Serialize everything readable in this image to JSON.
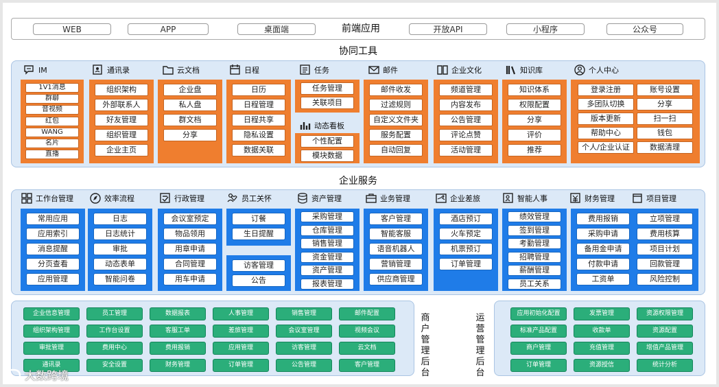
{
  "frontend": {
    "items": [
      "WEB",
      "APP",
      "桌面端",
      "前端应用",
      "开放API",
      "小程序",
      "公众号"
    ]
  },
  "collab": {
    "title": "协同工具",
    "columns": [
      {
        "name": "IM",
        "icon": "chat-icon",
        "items": [
          "1V1消息",
          "群聊",
          "音视频",
          "红包",
          "WANG",
          "名片",
          "直播"
        ]
      },
      {
        "name": "通讯录",
        "icon": "contacts-icon",
        "items": [
          "组织架构",
          "外部联系人",
          "好友管理",
          "组织管理",
          "企业主页"
        ]
      },
      {
        "name": "云文档",
        "icon": "folder-cloud-icon",
        "items": [
          "企业盘",
          "私人盘",
          "群文档",
          "分享"
        ]
      },
      {
        "name": "日程",
        "icon": "calendar-icon",
        "items": [
          "日历",
          "日程管理",
          "日程共享",
          "隐私设置",
          "数据关联"
        ]
      },
      {
        "name": "任务",
        "icon": "checklist-icon",
        "items": [
          "任务管理",
          "关联项目"
        ],
        "sub_name": "动态看板",
        "sub_icon": "bar-chart-icon",
        "sub_items": [
          "个性配置",
          "模块数据"
        ]
      },
      {
        "name": "邮件",
        "icon": "mail-icon",
        "items": [
          "邮件收发",
          "过滤规则",
          "自定义文件夹",
          "服务配置",
          "自动回复"
        ]
      },
      {
        "name": "企业文化",
        "icon": "book-icon",
        "items": [
          "频道管理",
          "内容发布",
          "公告管理",
          "评论点赞",
          "活动管理"
        ]
      },
      {
        "name": "知识库",
        "icon": "library-icon",
        "items": [
          "知识体系",
          "权限配置",
          "分享",
          "评价",
          "推荐"
        ]
      },
      {
        "name": "个人中心",
        "icon": "user-icon",
        "items": [
          "登录注册",
          "多团队切换",
          "版本更新",
          "帮助中心",
          "个人/企业认证"
        ],
        "items2": [
          "账号设置",
          "分享",
          "扫一扫",
          "钱包",
          "数据清理"
        ]
      }
    ]
  },
  "enterprise": {
    "title": "企业服务",
    "columns": [
      {
        "name": "工作台管理",
        "icon": "grid-icon",
        "items": [
          "常用应用",
          "应用索引",
          "消息提醒",
          "分页查看",
          "应用管理"
        ]
      },
      {
        "name": "效率流程",
        "icon": "compass-icon",
        "items": [
          "日志",
          "日志统计",
          "审批",
          "动态表单",
          "智能问卷"
        ]
      },
      {
        "name": "行政管理",
        "icon": "admin-icon",
        "items": [
          "会议室预定",
          "物品领用",
          "用章申请",
          "合同管理",
          "用车申请"
        ]
      },
      {
        "name": "员工关怀",
        "icon": "care-icon",
        "items": [
          "订餐",
          "生日提醒"
        ],
        "items2": [
          "访客管理",
          "公告"
        ]
      },
      {
        "name": "资产管理",
        "icon": "database-icon",
        "items": [
          "采购管理",
          "仓库管理",
          "销售管理",
          "资金管理",
          "资产管理",
          "报表管理"
        ]
      },
      {
        "name": "业务管理",
        "icon": "briefcase-icon",
        "items": [
          "客户管理",
          "智能客服",
          "语音机器人",
          "营销管理",
          "供应商管理"
        ]
      },
      {
        "name": "企业差旅",
        "icon": "travel-icon",
        "items": [
          "酒店预订",
          "火车预定",
          "机票预订",
          "订单管理"
        ]
      },
      {
        "name": "智能人事",
        "icon": "hr-icon",
        "items": [
          "绩效管理",
          "签到管理",
          "考勤管理",
          "招聘管理",
          "薪酬管理",
          "员工关系"
        ]
      },
      {
        "name": "财务管理",
        "icon": "yuan-icon",
        "items": [
          "费用报销",
          "采购申请",
          "备用金申请",
          "付款申请",
          "工资单"
        ]
      },
      {
        "name": "项目管理",
        "icon": "project-icon",
        "items": [
          "立项管理",
          "费用核算",
          "项目计划",
          "回款管理",
          "风险控制"
        ]
      }
    ]
  },
  "merchant": {
    "label": "商户管理后台",
    "rows": [
      [
        "企业信息管理",
        "员工管理",
        "数据报表",
        "人事管理",
        "销售管理",
        "邮件配置"
      ],
      [
        "组织架构管理",
        "工作台设置",
        "客服工单",
        "差旅管理",
        "会议室管理",
        "视频会议"
      ],
      [
        "审批管理",
        "费用中心",
        "费用报销",
        "应用管理",
        "访客管理",
        "云文档"
      ],
      [
        "通讯录",
        "安全设置",
        "财务管理",
        "订单管理",
        "公告管理",
        "客户管理"
      ]
    ]
  },
  "ops": {
    "label": "运营管理后台",
    "rows": [
      [
        "应用初始化配置",
        "发票管理",
        "资源权限管理"
      ],
      [
        "标准产品配置",
        "收款单",
        "资源配置"
      ],
      [
        "商户管理",
        "充值管理",
        "增值产品管理"
      ],
      [
        "订单管理",
        "资源授信",
        "统计分析"
      ]
    ]
  },
  "watermark": "大数跨境",
  "colors": {
    "orange": "#ef7e2f",
    "blue": "#1f7ce8",
    "green": "#2bae7a",
    "panel": "#dce9f7"
  }
}
